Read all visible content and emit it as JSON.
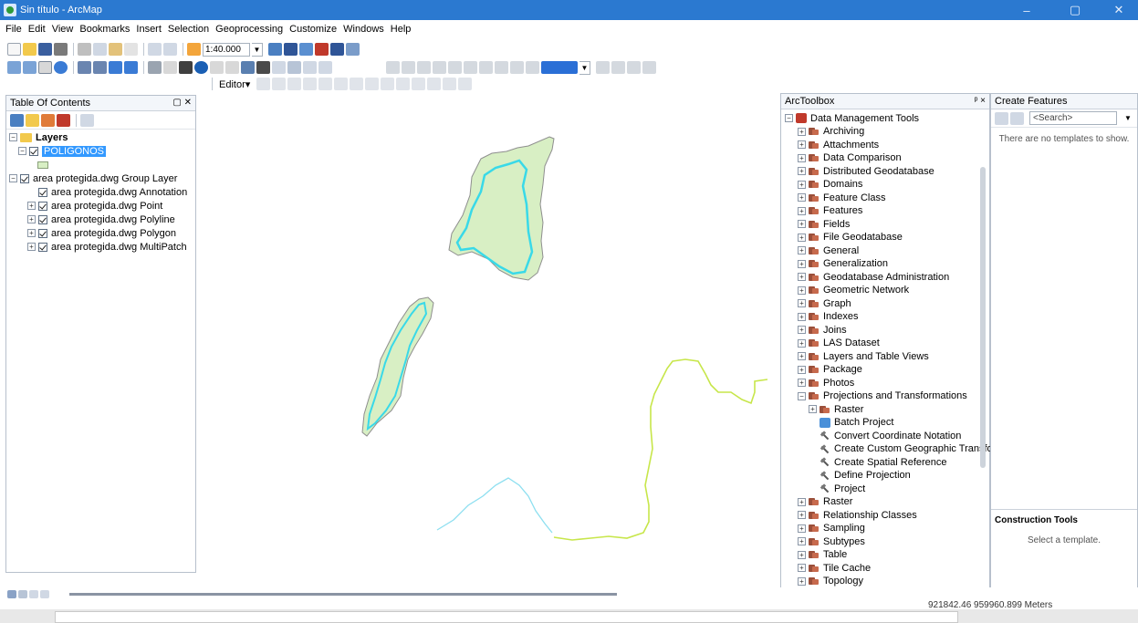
{
  "window": {
    "title": "Sin título - ArcMap",
    "controls": [
      "–",
      "▢",
      "✕"
    ]
  },
  "menu": [
    "File",
    "Edit",
    "View",
    "Bookmarks",
    "Insert",
    "Selection",
    "Geoprocessing",
    "Customize",
    "Windows",
    "Help"
  ],
  "toolbar": {
    "scale": "1:40.000",
    "editor_label": "Editor▾"
  },
  "toc": {
    "title": "Table Of Contents",
    "items": [
      {
        "label": "Layers",
        "level": 0,
        "bold": true
      },
      {
        "label": "POLIGONOS",
        "level": 1,
        "selected": true
      },
      {
        "label": "area protegida.dwg Group Layer",
        "level": 0
      },
      {
        "label": "area protegida.dwg Annotation",
        "level": 1
      },
      {
        "label": "area protegida.dwg Point",
        "level": 1
      },
      {
        "label": "area protegida.dwg Polyline",
        "level": 1
      },
      {
        "label": "area protegida.dwg Polygon",
        "level": 1
      },
      {
        "label": "area protegida.dwg MultiPatch",
        "level": 1
      }
    ]
  },
  "toolbox": {
    "title": "ArcToolbox",
    "header_controls": "ᵖ ×",
    "root": "Data Management Tools",
    "toolsets": [
      "Archiving",
      "Attachments",
      "Data Comparison",
      "Distributed Geodatabase",
      "Domains",
      "Feature Class",
      "Features",
      "Fields",
      "File Geodatabase",
      "General",
      "Generalization",
      "Geodatabase Administration",
      "Geometric Network",
      "Graph",
      "Indexes",
      "Joins",
      "LAS Dataset",
      "Layers and Table Views",
      "Package",
      "Photos",
      "Projections and Transformations"
    ],
    "projections_children": [
      {
        "label": "Raster",
        "kind": "toolset"
      },
      {
        "label": "Batch Project",
        "kind": "script"
      },
      {
        "label": "Convert Coordinate Notation",
        "kind": "tool"
      },
      {
        "label": "Create Custom Geographic Transforr",
        "kind": "tool"
      },
      {
        "label": "Create Spatial Reference",
        "kind": "tool"
      },
      {
        "label": "Define Projection",
        "kind": "tool"
      },
      {
        "label": "Project",
        "kind": "tool"
      }
    ],
    "after_toolsets": [
      "Raster",
      "Relationship Classes",
      "Sampling",
      "Subtypes",
      "Table",
      "Tile Cache",
      "Topology"
    ]
  },
  "create_features": {
    "title": "Create Features",
    "search_placeholder": "<Search>",
    "empty_message": "There are no templates to show.",
    "construction_tools_title": "Construction Tools",
    "construction_message": "Select a template."
  },
  "status": {
    "coordinates": "921842.46 959960.899 Meters"
  },
  "colors": {
    "titlebar": "#2b79d0",
    "polygon_fill": "#d8efc4",
    "polygon_outline": "#8e8e8e",
    "polygon_inner": "#39d9e8",
    "river_yellow": "#c7e64a",
    "river_cyan": "#8ddff0"
  }
}
